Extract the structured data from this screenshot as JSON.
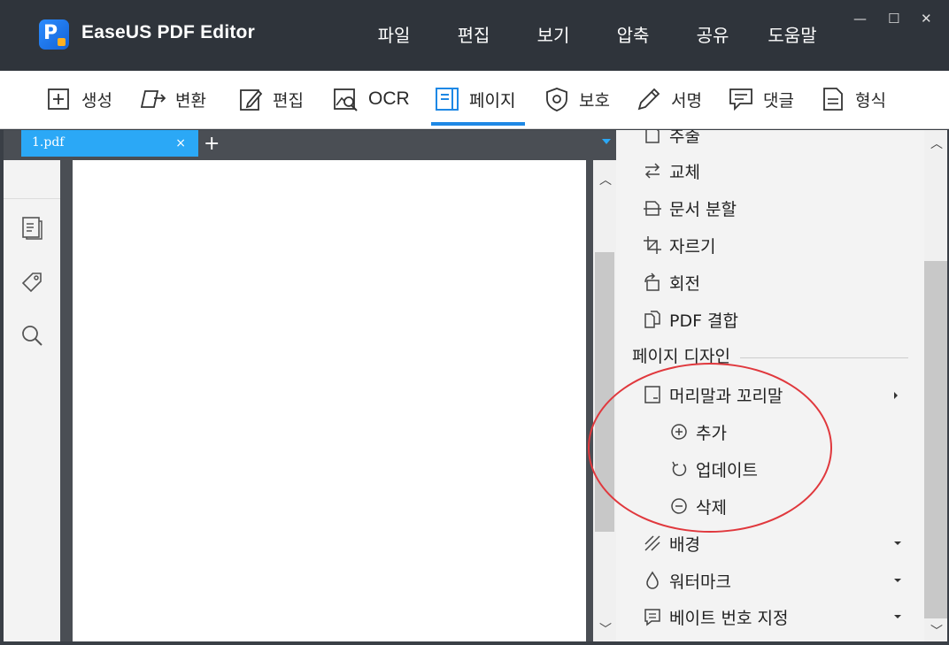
{
  "app": {
    "title": "EaseUS PDF Editor",
    "accent": "#1e88e5",
    "logo_letter": "P"
  },
  "menu": [
    "파일",
    "편집",
    "보기",
    "압축",
    "공유",
    "도움말"
  ],
  "window_controls": {
    "minimize": "—",
    "maximize": "☐",
    "close": "✕"
  },
  "toolbar": {
    "items": [
      {
        "label": "생성",
        "icon": "create-icon"
      },
      {
        "label": "변환",
        "icon": "convert-icon"
      },
      {
        "label": "편집",
        "icon": "edit-icon"
      },
      {
        "label": "OCR",
        "icon": "ocr-icon"
      },
      {
        "label": "페이지",
        "icon": "page-icon",
        "active": true
      },
      {
        "label": "보호",
        "icon": "shield-icon"
      },
      {
        "label": "서명",
        "icon": "sign-icon"
      },
      {
        "label": "댓글",
        "icon": "comment-icon"
      },
      {
        "label": "형식",
        "icon": "form-icon"
      }
    ]
  },
  "tabs": {
    "active": "1.pdf",
    "close": "×",
    "add": "+"
  },
  "page_panel": {
    "items": [
      {
        "label": "추출",
        "icon": "extract-icon"
      },
      {
        "label": "교체",
        "icon": "replace-icon"
      },
      {
        "label": "문서 분할",
        "icon": "split-icon"
      },
      {
        "label": "자르기",
        "icon": "crop-icon"
      },
      {
        "label": "회전",
        "icon": "rotate-icon"
      },
      {
        "label": "PDF 결합",
        "icon": "merge-icon"
      }
    ],
    "design_section": "페이지 디자인",
    "header_footer": {
      "label": "머리말과 꼬리말",
      "icon": "header-footer-icon"
    },
    "header_footer_sub": [
      {
        "label": "추가",
        "icon": "plus-circle-icon"
      },
      {
        "label": "업데이트",
        "icon": "refresh-icon"
      },
      {
        "label": "삭제",
        "icon": "minus-circle-icon"
      }
    ],
    "design_items": [
      {
        "label": "배경",
        "icon": "background-icon"
      },
      {
        "label": "워터마크",
        "icon": "watermark-icon"
      },
      {
        "label": "베이트 번호 지정",
        "icon": "bates-icon"
      }
    ]
  }
}
